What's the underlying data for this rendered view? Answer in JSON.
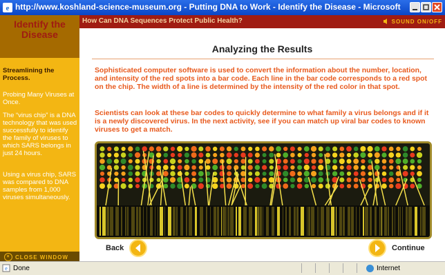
{
  "window": {
    "title": "http://www.koshland-science-museum.org - Putting DNA to Work - Identify the Disease - Microsoft Internet Explorer"
  },
  "sidebar": {
    "section_title": "Identify the Disease",
    "heading": "Streamlining the Process.",
    "items": [
      "Probing Many Viruses at Once.",
      "The “virus chip” is a DNA technology that was used successfully to identify the family of viruses to which SARS belongs in just 24 hours.",
      "Using a virus chip, SARS was compared to DNA samples from 1,000 viruses simultaneously."
    ],
    "close_window": "CLOSE WINDOW"
  },
  "banner": {
    "question": "How Can DNA Sequences Protect Public Health?",
    "sound": "SOUND ON/OFF"
  },
  "main": {
    "title": "Analyzing the Results",
    "paragraphs": [
      "Sophisticated computer software is used to convert the information about the number, location, and intensity of the red spots into a bar code.  Each line in the bar code corresponds to a red spot on the chip.  The width of a line is determined by the intensity of the red color in that spot.",
      "Scientists can look at these bar codes to quickly determine to what family a virus belongs and if it is a newly discovered virus.  In the next activity, see if you can match up viral bar codes to known viruses to get a match."
    ],
    "back_label": "Back",
    "continue_label": "Continue"
  },
  "statusbar": {
    "status": "Done",
    "zone": "Internet"
  },
  "colors": {
    "sidebar": "#f3b613",
    "banner": "#a01c12",
    "body_text": "#e85a1e",
    "chip_bg": "#1b1b0f"
  }
}
